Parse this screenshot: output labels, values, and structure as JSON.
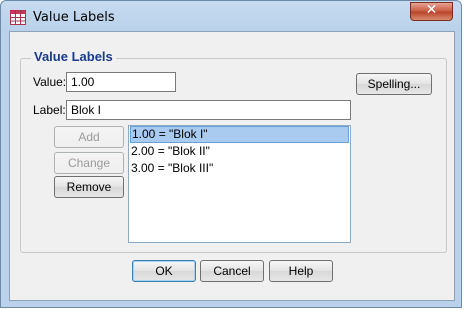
{
  "window": {
    "title": "Value Labels",
    "close_glyph": "✕"
  },
  "group": {
    "title": "Value Labels"
  },
  "value": {
    "label": "Value:",
    "text": "1.00"
  },
  "label": {
    "label": "Label:",
    "text": "Blok I"
  },
  "buttons": {
    "spelling": "Spelling...",
    "add": "Add",
    "change": "Change",
    "remove": "Remove",
    "ok": "OK",
    "cancel": "Cancel",
    "help": "Help"
  },
  "list": {
    "items": [
      "1.00 = \"Blok I\"",
      "2.00 = \"Blok II\"",
      "3.00 = \"Blok III\""
    ],
    "selected_index": 0
  },
  "icons": {
    "app": "table-grid-icon",
    "close": "close-icon"
  },
  "colors": {
    "group_title": "#1a3a8a",
    "selection": "#a8cbef",
    "titlebar": "#b9d1ea"
  }
}
